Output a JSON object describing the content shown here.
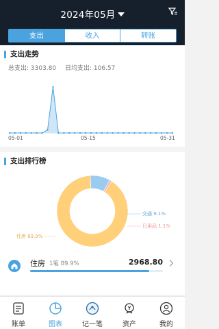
{
  "header": {
    "month": "2024年05月",
    "tabs": [
      {
        "label": "支出",
        "active": true
      },
      {
        "label": "收入",
        "active": false
      },
      {
        "label": "转账",
        "active": false
      }
    ]
  },
  "trend": {
    "title": "支出走势",
    "total_label": "总支出: 3303.80",
    "daily_avg_label": "日均支出: 106.57",
    "x_ticks": [
      "05-01",
      "05-15",
      "05-31"
    ]
  },
  "ranking": {
    "title": "支出排行榜",
    "pie_labels": [
      {
        "text": "交通 9.1%"
      },
      {
        "text": "日用品 1.1%"
      },
      {
        "text": "住房 89.9%"
      }
    ],
    "top_item": {
      "name": "住房",
      "meta": "1笔 89.9%",
      "amount": "2968.80"
    }
  },
  "chart_data": {
    "type": "line",
    "title": "",
    "x": [
      "05-01",
      "05-02",
      "05-03",
      "05-04",
      "05-05",
      "05-06",
      "05-07",
      "05-08",
      "05-09",
      "05-10",
      "05-11",
      "05-12",
      "05-13",
      "05-14",
      "05-15",
      "05-16",
      "05-17",
      "05-18",
      "05-19",
      "05-20",
      "05-21",
      "05-22",
      "05-23",
      "05-24",
      "05-25",
      "05-26",
      "05-27",
      "05-28",
      "05-29",
      "05-30",
      "05-31"
    ],
    "series": [
      {
        "values": [
          0,
          0,
          0,
          0,
          0,
          0,
          0,
          200,
          2968.8,
          0,
          0,
          0,
          0,
          0,
          0,
          0,
          0,
          0,
          0,
          0,
          0,
          0,
          0,
          0,
          0,
          0,
          0,
          0,
          0,
          0,
          0
        ]
      }
    ],
    "xlabel": "",
    "ylabel": "",
    "ylim": [
      0,
      3000
    ],
    "grid": false,
    "pie": {
      "type": "pie",
      "donut": true,
      "slices": [
        {
          "name": "住房",
          "percent": 89.9,
          "color": "#ffcf7a"
        },
        {
          "name": "交通",
          "percent": 9.1,
          "color": "#9ccbf0"
        },
        {
          "name": "日用品",
          "percent": 1.1,
          "color": "#f5b8b8"
        }
      ]
    }
  },
  "colors": {
    "accent": "#4aa3df",
    "header_bg": "#16202c"
  },
  "nav": [
    {
      "label": "账单",
      "icon": "bill-icon",
      "active": false
    },
    {
      "label": "图表",
      "icon": "chart-icon",
      "active": true
    },
    {
      "label": "记一笔",
      "icon": "add-record-icon",
      "active": false
    },
    {
      "label": "资产",
      "icon": "assets-icon",
      "active": false
    },
    {
      "label": "我的",
      "icon": "profile-icon",
      "active": false
    }
  ]
}
